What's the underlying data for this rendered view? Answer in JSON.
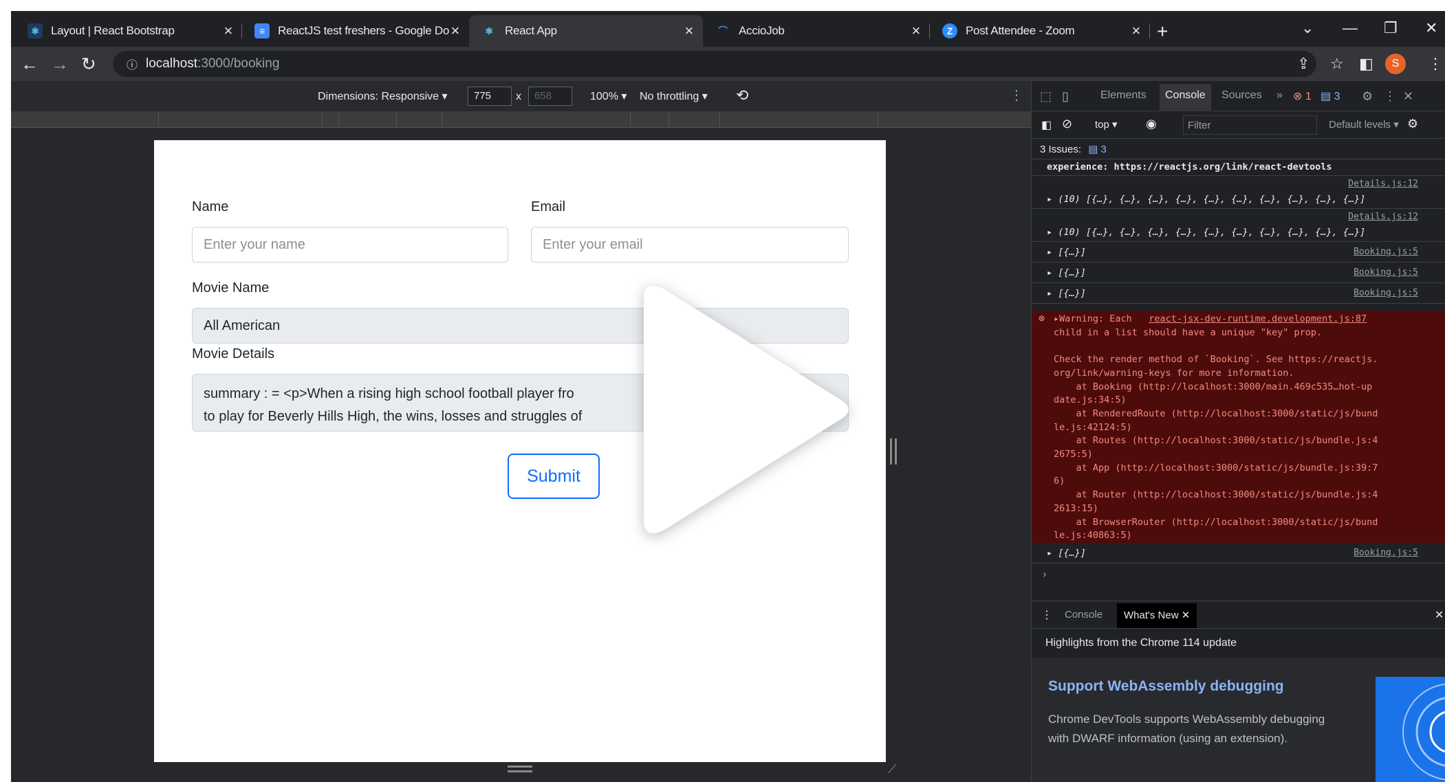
{
  "tabs": [
    {
      "title": "Layout | React Bootstrap",
      "icon": "react-bootstrap-icon"
    },
    {
      "title": "ReactJS test freshers - Google Do",
      "icon": "google-docs-icon"
    },
    {
      "title": "React App",
      "icon": "react-icon"
    },
    {
      "title": "AccioJob",
      "icon": "acciojob-icon"
    },
    {
      "title": "Post Attendee - Zoom",
      "icon": "zoom-icon"
    }
  ],
  "address": {
    "host": "localhost",
    "path": ":3000/booking"
  },
  "profile_initial": "S",
  "device_toolbar": {
    "dimensions": "Dimensions: Responsive ▾",
    "width": "775",
    "times": "x",
    "height": "658",
    "zoom": "100% ▾",
    "throttling": "No throttling ▾"
  },
  "form": {
    "name_label": "Name",
    "name_placeholder": "Enter your name",
    "email_label": "Email",
    "email_placeholder": "Enter your email",
    "movie_name_label": "Movie Name",
    "movie_name_value": "All American",
    "movie_details_label": "Movie Details",
    "movie_details_line1": "summary :  = <p>When a rising high school football player fro",
    "movie_details_line2": "to play for Beverly Hills High, the wins, losses and struggles of",
    "submit_label": "Submit"
  },
  "devtools": {
    "tabs": [
      "Elements",
      "Console",
      "Sources",
      "»"
    ],
    "error_count": "1",
    "issue_count": "3",
    "context": "top ▾",
    "filter_placeholder": "Filter",
    "levels": "Default levels ▾",
    "issues_label": "3 Issues:",
    "issues_count": "3",
    "console_lines": [
      {
        "text": "experience: https://reactjs.org/link/react-devtools",
        "src": ""
      },
      {
        "text": "▸ (10) [{…}, {…}, {…}, {…}, {…}, {…}, {…}, {…}, {…}, {…}]",
        "src": "Details.js:12"
      },
      {
        "text": "▸ (10) [{…}, {…}, {…}, {…}, {…}, {…}, {…}, {…}, {…}, {…}]",
        "src": "Details.js:12"
      },
      {
        "text": "▸ [{…}]",
        "src": "Booking.js:5"
      },
      {
        "text": "▸ [{…}]",
        "src": "Booking.js:5"
      },
      {
        "text": "▸ [{…}]",
        "src": "Booking.js:5"
      }
    ],
    "warning": {
      "head": "▸Warning: Each",
      "src": "react-jsx-dev-runtime.development.js:87",
      "lines": [
        "child in a list should have a unique \"key\" prop.",
        "",
        "Check the render method of `Booking`. See https://reactjs.",
        "org/link/warning-keys for more information.",
        "    at Booking (http://localhost:3000/main.469c535…hot-up",
        "date.js:34:5)",
        "    at RenderedRoute (http://localhost:3000/static/js/bund",
        "le.js:42124:5)",
        "    at Routes (http://localhost:3000/static/js/bundle.js:4",
        "2675:5)",
        "    at App (http://localhost:3000/static/js/bundle.js:39:7",
        "6)",
        "    at Router (http://localhost:3000/static/js/bundle.js:4",
        "2613:15)",
        "    at BrowserRouter (http://localhost:3000/static/js/bund",
        "le.js:40863:5)"
      ]
    },
    "last_line": {
      "text": "▸ [{…}]",
      "src": "Booking.js:5"
    },
    "prompt": "›",
    "drawer_tabs": [
      "Console",
      "What's New"
    ],
    "highlights": "Highlights from the Chrome 114 update",
    "wn_title": "Support WebAssembly debugging",
    "wn_body": "Chrome DevTools supports WebAssembly debugging with DWARF information (using an extension)."
  }
}
